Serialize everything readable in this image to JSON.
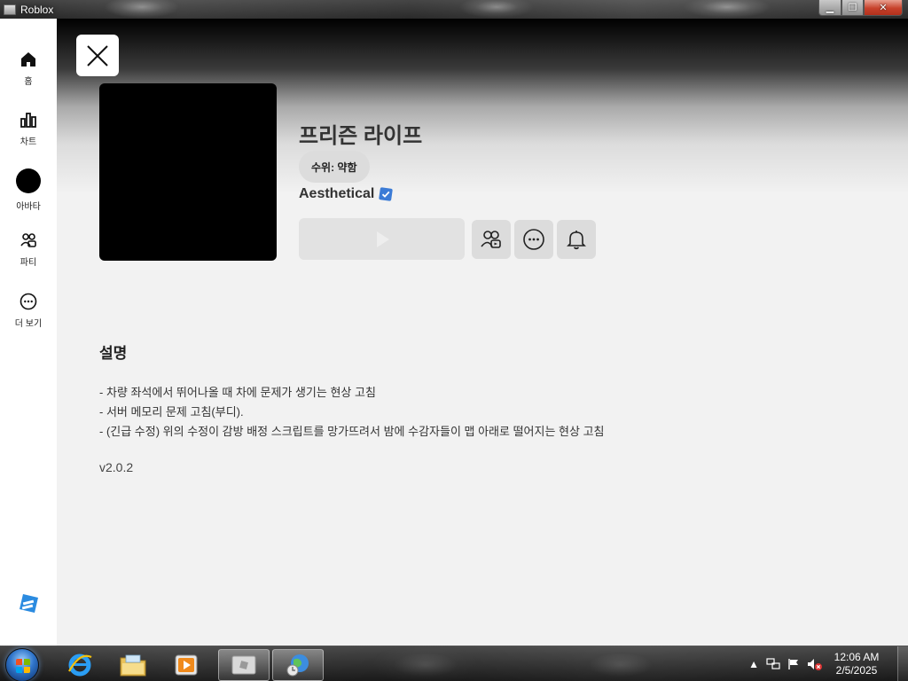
{
  "window": {
    "title": "Roblox"
  },
  "sidebar": {
    "items": [
      {
        "label": "홈",
        "icon": "home-icon"
      },
      {
        "label": "차트",
        "icon": "charts-icon"
      },
      {
        "label": "아바타",
        "icon": "avatar-icon"
      },
      {
        "label": "파티",
        "icon": "party-icon"
      },
      {
        "label": "더 보기",
        "icon": "more-icon"
      }
    ]
  },
  "game": {
    "title": "프리즌 라이프",
    "maturity": "수위: 약함",
    "creator": "Aesthetical",
    "creator_verified": true
  },
  "description": {
    "heading": "설명",
    "lines": [
      "- 차량 좌석에서 뛰어나올 때 차에 문제가 생기는 현상 고침",
      "- 서버 메모리 문제 고침(부디).",
      "- (긴급 수정) 위의 수정이 감방 배정 스크립트를 망가뜨려서 밤에 수감자들이 맵 아래로 떨어지는 현상 고침"
    ],
    "version": "v2.0.2"
  },
  "taskbar": {
    "time": "12:06 AM",
    "date": "2/5/2025"
  },
  "colors": {
    "accent_verified": "#3b7bd6",
    "sidebar_bg": "#ffffff",
    "content_bg": "#f2f2f2"
  }
}
